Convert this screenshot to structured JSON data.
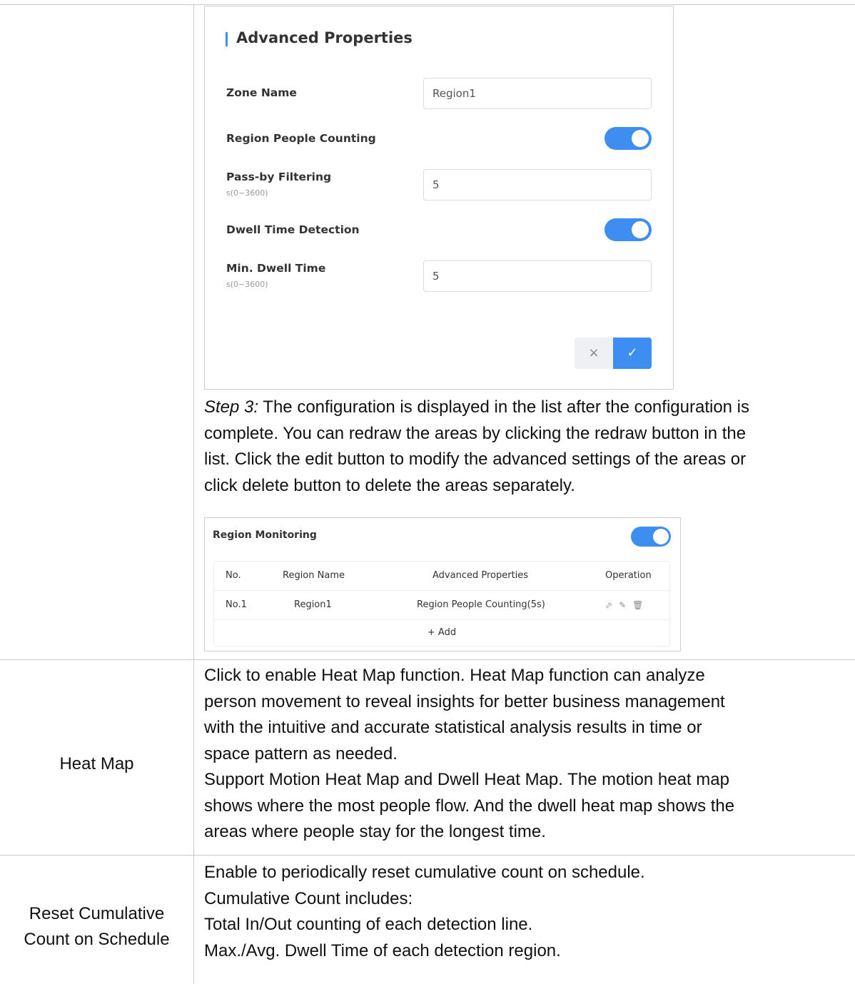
{
  "advanced_properties": {
    "title": "Advanced Properties",
    "zone_name_label": "Zone Name",
    "zone_name_value": "Region1",
    "region_people_counting_label": "Region People Counting",
    "region_people_counting_on": true,
    "pass_by_label": "Pass-by Filtering",
    "pass_by_hint": "s(0~3600)",
    "pass_by_value": "5",
    "dwell_detection_label": "Dwell Time Detection",
    "dwell_detection_on": true,
    "min_dwell_label": "Min. Dwell Time",
    "min_dwell_hint": "s(0~3600)",
    "min_dwell_value": "5",
    "cancel_icon": "×",
    "confirm_icon": "✓"
  },
  "step3": {
    "label": "Step 3:",
    "lines": [
      "The configuration is displayed in the list after the configuration is",
      "complete. You can redraw the areas by clicking the redraw button in the",
      "list. Click the edit button to modify the advanced settings of the areas or",
      "click delete button to delete the areas separately."
    ]
  },
  "region_monitoring": {
    "title": "Region Monitoring",
    "enabled": true,
    "headers": [
      "No.",
      "Region Name",
      "Advanced Properties",
      "Operation"
    ],
    "row": {
      "no": "No.1",
      "name": "Region1",
      "props": "Region People Counting(5s)"
    },
    "operation_icons": [
      "redraw-icon",
      "edit-icon",
      "delete-icon"
    ],
    "add_label": "+ Add"
  },
  "heat_map": {
    "name": "Heat Map",
    "lines": [
      "Click to enable Heat Map function. Heat Map function can analyze",
      "person movement to reveal insights for better business management",
      "with the intuitive and accurate statistical analysis results in time or",
      "space pattern as needed.",
      "Support Motion Heat Map and Dwell Heat Map. The motion heat map",
      "shows where the most people flow. And the dwell heat map shows the",
      "areas where people stay for the longest time."
    ]
  },
  "reset_count": {
    "name_line1": "Reset Cumulative",
    "name_line2": "Count on Schedule",
    "lines": [
      "Enable to periodically reset cumulative count on schedule.",
      "Cumulative Count includes:",
      "Total In/Out counting of each detection line.",
      "Max./Avg. Dwell Time of each detection region."
    ]
  },
  "colors": {
    "accent": "#3d8ef0",
    "border": "#c8c8c8"
  }
}
